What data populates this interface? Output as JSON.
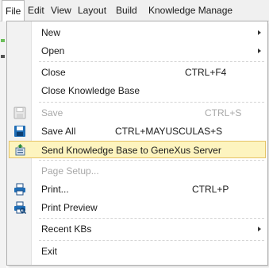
{
  "menubar": {
    "items": [
      "File",
      "Edit",
      "View",
      "Layout",
      "Build",
      "Knowledge Manage"
    ]
  },
  "file_menu": {
    "new": "New",
    "open": "Open",
    "close": "Close",
    "close_accel": "CTRL+F4",
    "close_kb": "Close Knowledge Base",
    "save": "Save",
    "save_accel": "CTRL+S",
    "save_all": "Save All",
    "save_all_accel": "CTRL+MAYUSCULAS+S",
    "send_kb": "Send Knowledge Base to GeneXus Server",
    "page_setup": "Page Setup...",
    "print": "Print...",
    "print_accel": "CTRL+P",
    "print_preview": "Print Preview",
    "recent_kbs": "Recent KBs",
    "exit": "Exit"
  },
  "colors": {
    "highlight_bg": "#fdf4bf",
    "highlight_border": "#e5c365",
    "icon_blue": "#1f6db5",
    "disabled_text": "#a8a8a8"
  },
  "icons": {
    "save": "floppy-disk-icon",
    "save_all": "floppy-disk-stack-icon",
    "send_kb": "server-upload-icon",
    "print": "printer-icon",
    "print_preview": "print-preview-icon",
    "submenu": "chevron-right-icon"
  }
}
